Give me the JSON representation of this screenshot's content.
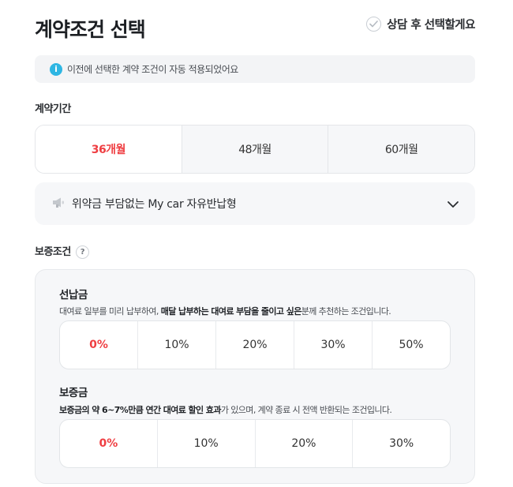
{
  "header": {
    "title": "계약조건 선택",
    "consult_label": "상담 후 선택할게요"
  },
  "notice": {
    "icon": "info-icon",
    "text": "이전에 선택한 계약 조건이 자동 적용되었어요"
  },
  "period": {
    "label": "계약기간",
    "options": [
      "36개월",
      "48개월",
      "60개월"
    ],
    "selected": "36개월"
  },
  "accordion": {
    "icon": "megaphone-icon",
    "text": "위약금 부담없는 My car 자유반납형"
  },
  "guarantee": {
    "label": "보증조건",
    "prepayment": {
      "title": "선납금",
      "desc_pre": "대여료 일부를 미리 납부하여, ",
      "desc_bold": "매달 납부하는 대여료 부담을 줄이고 싶은",
      "desc_post": "분께 추천하는 조건입니다.",
      "options": [
        "0%",
        "10%",
        "20%",
        "30%",
        "50%"
      ],
      "selected": "0%"
    },
    "deposit": {
      "title": "보증금",
      "desc_bold": "보증금의 약 6~7%만큼 연간 대여료 할인 효과",
      "desc_post": "가 있으며, 계약 종료 시 전액 반환되는 조건입니다.",
      "options": [
        "0%",
        "10%",
        "20%",
        "30%"
      ],
      "selected": "0%"
    }
  },
  "colors": {
    "accent": "#ef3e42",
    "info": "#2eb6e3",
    "panel": "#f6f7f9"
  }
}
